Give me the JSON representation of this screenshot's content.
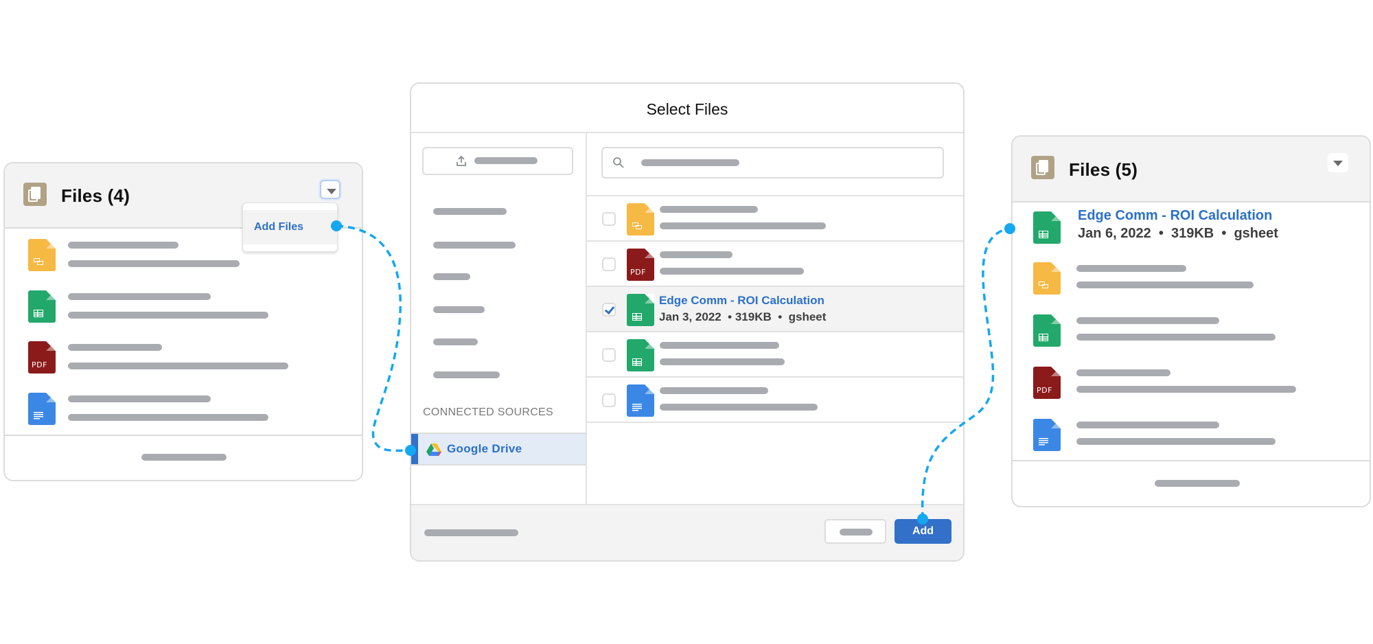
{
  "colors": {
    "accent_blue": "#2b70c9",
    "connector_blue": "#14a7f2",
    "card_icon": "#b0a285",
    "slides": "#f6b944",
    "sheet": "#22a86b",
    "pdf": "#8b1a1a",
    "doc": "#3b87e6",
    "placeholder_bar": "#a8abb0"
  },
  "left_card": {
    "title": "Files (4)",
    "icon": "files-icon",
    "menu_button_icon": "chevron-down-icon",
    "dropdown": {
      "items": [
        {
          "label": "Add Files"
        }
      ]
    },
    "files": [
      {
        "type": "slides",
        "icon": "google-slides-icon"
      },
      {
        "type": "sheet",
        "icon": "google-sheets-icon"
      },
      {
        "type": "pdf",
        "icon": "pdf-icon",
        "glyph_text": "PDF"
      },
      {
        "type": "doc",
        "icon": "google-docs-icon"
      }
    ]
  },
  "dialog": {
    "title": "Select Files",
    "upload_icon": "upload-icon",
    "search_icon": "search-icon",
    "connected_sources_label": "CONNECTED SOURCES",
    "sources": [
      {
        "label": "Google Drive",
        "icon": "google-drive-icon",
        "selected": true
      }
    ],
    "files": [
      {
        "type": "slides",
        "checked": false
      },
      {
        "type": "pdf",
        "checked": false,
        "glyph_text": "PDF"
      },
      {
        "type": "sheet",
        "checked": true,
        "name": "Edge Comm - ROI Calculation",
        "meta": "Jan 3, 2022  • 319KB  •  gsheet"
      },
      {
        "type": "sheet",
        "checked": false
      },
      {
        "type": "doc",
        "checked": false
      }
    ],
    "add_button_label": "Add"
  },
  "right_card": {
    "title": "Files (5)",
    "icon": "files-icon",
    "menu_button_icon": "chevron-down-icon",
    "files": [
      {
        "type": "sheet",
        "name": "Edge Comm - ROI Calculation",
        "meta": "Jan 6, 2022  •  319KB  •  gsheet"
      },
      {
        "type": "slides"
      },
      {
        "type": "sheet"
      },
      {
        "type": "pdf",
        "glyph_text": "PDF"
      },
      {
        "type": "doc"
      }
    ]
  }
}
